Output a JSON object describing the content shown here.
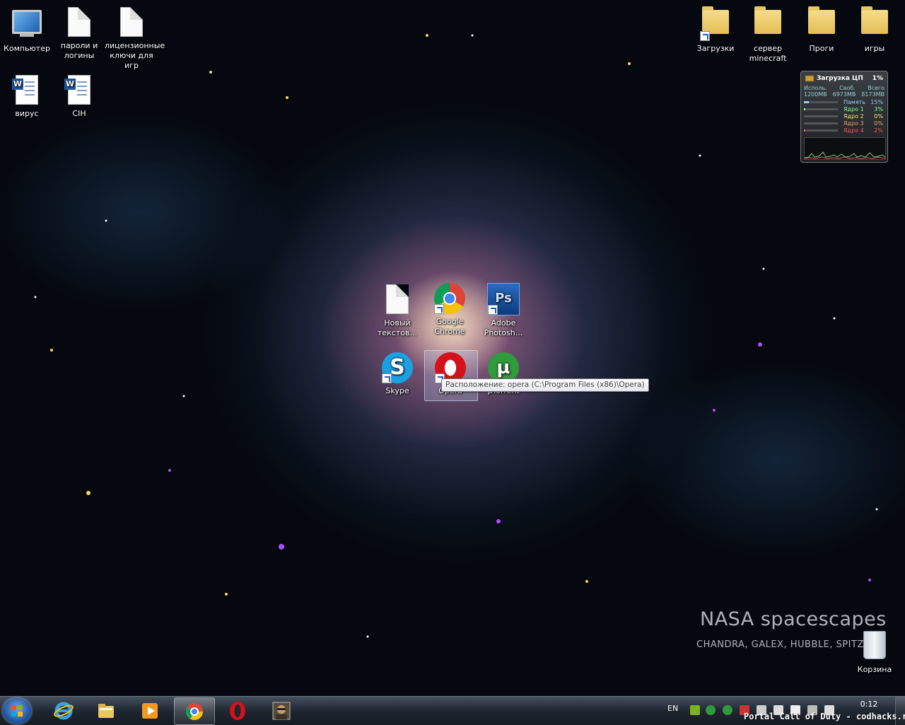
{
  "desktop_icons_left": [
    {
      "label": "Компьютер",
      "icon": "computer-icon"
    },
    {
      "label": "пароли и логины",
      "icon": "text-file-icon"
    },
    {
      "label": "лицензионные ключи для игр",
      "icon": "text-file-icon"
    },
    {
      "label": "вирус",
      "icon": "word-document-icon"
    },
    {
      "label": "CIH",
      "icon": "word-document-icon"
    }
  ],
  "desktop_icons_right": [
    {
      "label": "Загрузки",
      "icon": "downloads-folder-icon"
    },
    {
      "label": "сервер minecraft",
      "icon": "folder-icon"
    },
    {
      "label": "Проги",
      "icon": "folder-icon"
    },
    {
      "label": "игры",
      "icon": "folder-icon"
    }
  ],
  "desktop_icons_center": [
    {
      "label": "Новый текстов...",
      "icon": "text-file-icon"
    },
    {
      "label": "Google Chrome",
      "icon": "chrome-icon"
    },
    {
      "label": "Adobe Photosh...",
      "icon": "photoshop-icon"
    },
    {
      "label": "Skype",
      "icon": "skype-icon"
    },
    {
      "label": "Opera",
      "icon": "opera-icon"
    },
    {
      "label": "µTorrent",
      "icon": "utorrent-icon"
    }
  ],
  "recycle_bin": {
    "label": "Корзина"
  },
  "tooltip": {
    "text": "Расположение: opera (C:\\Program Files (x86)\\Opera)"
  },
  "wallpaper": {
    "title": "NASA spacescapes",
    "subtitle": "CHANDRA, GALEX, HUBBLE, SPITZ"
  },
  "cpu_gadget": {
    "title": "Загрузка ЦП",
    "total_percent": "1%",
    "headers": [
      "Исполь.",
      "Своб.",
      "Всего"
    ],
    "values": [
      "1200MB",
      "6973MB",
      "8173MB"
    ],
    "rows": [
      {
        "name": "Память",
        "value": "15%",
        "level": 0.15,
        "color": "#9cf"
      },
      {
        "name": "Ядро 1",
        "value": "3%",
        "level": 0.03,
        "color": "#8f8"
      },
      {
        "name": "Ядро 2",
        "value": "0%",
        "level": 0.0,
        "color": "#ee6"
      },
      {
        "name": "Ядро 3",
        "value": "0%",
        "level": 0.0,
        "color": "#f96"
      },
      {
        "name": "Ядро 4",
        "value": "2%",
        "level": 0.02,
        "color": "#f55"
      }
    ]
  },
  "taskbar": {
    "items": [
      {
        "name": "internet-explorer",
        "active": false
      },
      {
        "name": "explorer-folder",
        "active": false
      },
      {
        "name": "media-player",
        "active": false
      },
      {
        "name": "google-chrome",
        "active": true
      },
      {
        "name": "opera",
        "active": false
      },
      {
        "name": "game-app",
        "active": false
      }
    ],
    "language": "EN",
    "time": "0:12"
  },
  "watermark": "Portal Call of Duty - codhacks.ru",
  "colors": {
    "taskbar": "#1e2630",
    "tooltip_border": "#767676",
    "accent": "#1c4e96"
  }
}
